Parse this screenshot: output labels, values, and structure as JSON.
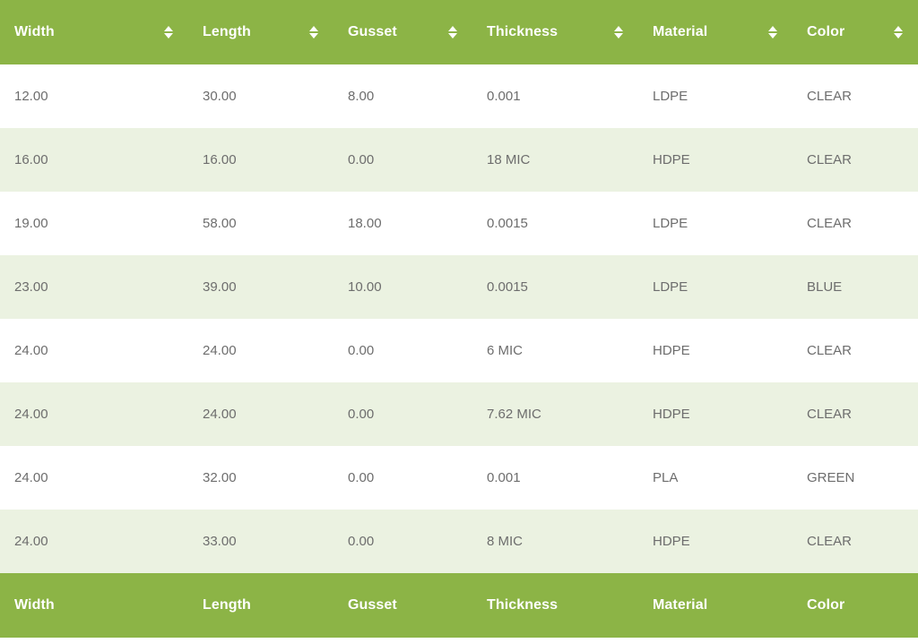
{
  "table": {
    "columns": [
      {
        "key": "width",
        "label": "Width",
        "sortable": true,
        "sort_icon": "sort-updown-icon"
      },
      {
        "key": "length",
        "label": "Length",
        "sortable": true,
        "sort_icon": "sort-updown-icon"
      },
      {
        "key": "gusset",
        "label": "Gusset",
        "sortable": true,
        "sort_icon": "sort-updown-icon"
      },
      {
        "key": "thickness",
        "label": "Thickness",
        "sortable": true,
        "sort_icon": "sort-updown-icon"
      },
      {
        "key": "material",
        "label": "Material",
        "sortable": true,
        "sort_icon": "sort-updown-icon"
      },
      {
        "key": "color",
        "label": "Color",
        "sortable": true,
        "sort_icon": "sort-updown-icon"
      }
    ],
    "footer_columns": [
      {
        "key": "width",
        "label": "Width"
      },
      {
        "key": "length",
        "label": "Length"
      },
      {
        "key": "gusset",
        "label": "Gusset"
      },
      {
        "key": "thickness",
        "label": "Thickness"
      },
      {
        "key": "material",
        "label": "Material"
      },
      {
        "key": "color",
        "label": "Color"
      }
    ],
    "rows": [
      {
        "width": "12.00",
        "length": "30.00",
        "gusset": "8.00",
        "thickness": "0.001",
        "material": "LDPE",
        "color": "CLEAR"
      },
      {
        "width": "16.00",
        "length": "16.00",
        "gusset": "0.00",
        "thickness": "18 MIC",
        "material": "HDPE",
        "color": "CLEAR"
      },
      {
        "width": "19.00",
        "length": "58.00",
        "gusset": "18.00",
        "thickness": "0.0015",
        "material": "LDPE",
        "color": "CLEAR"
      },
      {
        "width": "23.00",
        "length": "39.00",
        "gusset": "10.00",
        "thickness": "0.0015",
        "material": "LDPE",
        "color": "BLUE"
      },
      {
        "width": "24.00",
        "length": "24.00",
        "gusset": "0.00",
        "thickness": "6 MIC",
        "material": "HDPE",
        "color": "CLEAR"
      },
      {
        "width": "24.00",
        "length": "24.00",
        "gusset": "0.00",
        "thickness": "7.62 MIC",
        "material": "HDPE",
        "color": "CLEAR"
      },
      {
        "width": "24.00",
        "length": "32.00",
        "gusset": "0.00",
        "thickness": "0.001",
        "material": "PLA",
        "color": "GREEN"
      },
      {
        "width": "24.00",
        "length": "33.00",
        "gusset": "0.00",
        "thickness": "8 MIC",
        "material": "HDPE",
        "color": "CLEAR"
      }
    ]
  },
  "colors": {
    "header_green": "#8cb446",
    "row_alt_green": "#ebf2e1",
    "row_base": "#ffffff",
    "header_text": "#ffffff",
    "cell_text": "#6d6d6d"
  }
}
